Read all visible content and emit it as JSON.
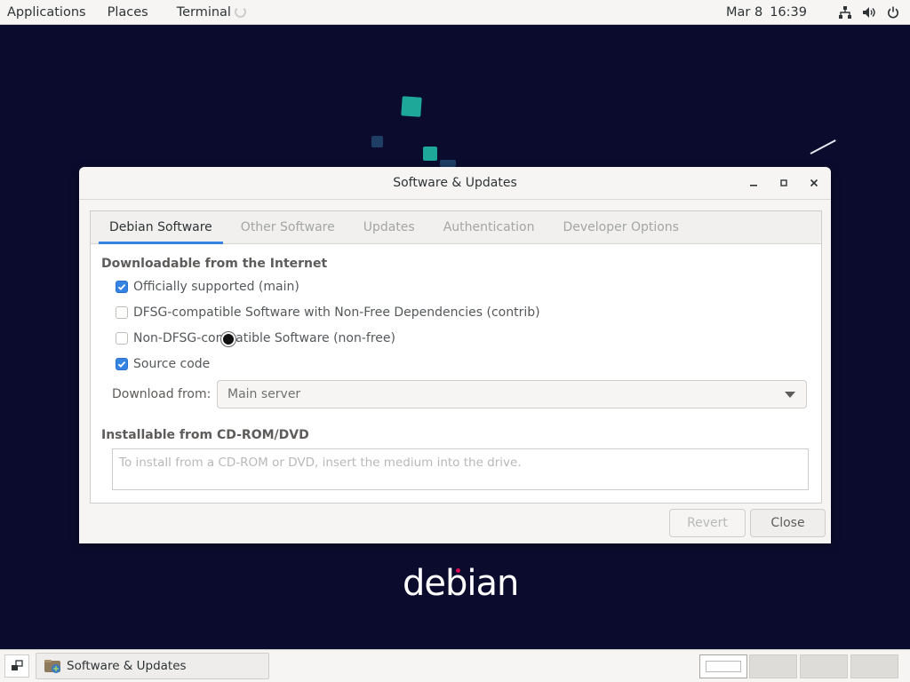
{
  "topbar": {
    "applications_label": "Applications",
    "places_label": "Places",
    "terminal_label": "Terminal",
    "date": "Mar 8",
    "time": "16:39",
    "icons": [
      "network-icon",
      "volume-icon",
      "power-icon"
    ]
  },
  "desktop": {
    "logo_text": "debian"
  },
  "window": {
    "title": "Software & Updates",
    "tabs": [
      {
        "label": "Debian Software",
        "active": true
      },
      {
        "label": "Other Software",
        "active": false
      },
      {
        "label": "Updates",
        "active": false
      },
      {
        "label": "Authentication",
        "active": false
      },
      {
        "label": "Developer Options",
        "active": false
      }
    ],
    "section_downloadable": "Downloadable from the Internet",
    "components": [
      {
        "label": "Officially supported (main)",
        "checked": true
      },
      {
        "label": "DFSG-compatible Software with Non-Free Dependencies (contrib)",
        "checked": false
      },
      {
        "label": "Non-DFSG-compatible Software (non-free)",
        "checked": false
      },
      {
        "label": "Source code",
        "checked": true
      }
    ],
    "download_from_label": "Download from:",
    "download_from_value": "Main server",
    "section_cdrom": "Installable from CD-ROM/DVD",
    "cdrom_message": "To install from a CD-ROM or DVD, insert the medium into the drive.",
    "revert_label": "Revert",
    "close_label": "Close"
  },
  "taskbar": {
    "task_label": "Software & Updates",
    "workspaces": 4,
    "active_workspace": 1
  },
  "colors": {
    "accent": "#3584e4",
    "desktop_bg": "#0b0b2e",
    "teal": "#1ea89a"
  }
}
